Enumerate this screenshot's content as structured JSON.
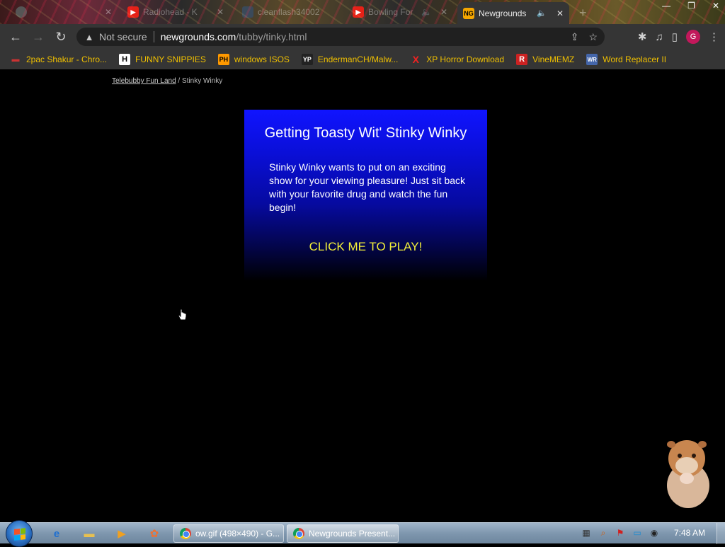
{
  "tabs": [
    {
      "title": "",
      "fav": "",
      "kind": "blank",
      "active": false
    },
    {
      "title": "Radiohead - K",
      "fav": "▶",
      "kind": "yt",
      "active": false
    },
    {
      "title": "cleanflash34002",
      "fav": "",
      "kind": "blank",
      "active": false
    },
    {
      "title": "Bowling For",
      "fav": "▶",
      "kind": "yt",
      "active": false
    },
    {
      "title": "Newgrounds",
      "fav": "NG",
      "kind": "ng",
      "active": true
    }
  ],
  "toolbar": {
    "security_label": "Not secure",
    "url_host": "newgrounds.com",
    "url_path": "/tubby/tinky.html",
    "profile_initial": "G"
  },
  "bookmarks": [
    {
      "label": "2pac Shakur - Chro...",
      "icon": "▬",
      "color": "#c33"
    },
    {
      "label": "FUNNY SNIPPIES",
      "icon": "H",
      "color": "#222"
    },
    {
      "label": "windows ISOS",
      "icon": "PH",
      "color": "#f90"
    },
    {
      "label": "EndermanCH/Malw...",
      "icon": "YP",
      "color": "#222"
    },
    {
      "label": "XP Horror Download",
      "icon": "X",
      "color": "#e22"
    },
    {
      "label": "VineMEMZ",
      "icon": "R",
      "color": "#c22"
    },
    {
      "label": "Word Replacer II",
      "icon": "WR",
      "color": "#468"
    }
  ],
  "page": {
    "breadcrumb_link": "Telebubby Fun Land",
    "breadcrumb_sep": " / ",
    "breadcrumb_current": "Stinky Winky",
    "promo_title": "Getting Toasty Wit' Stinky Winky",
    "promo_description": "Stinky Winky wants to put on an exciting show for your viewing pleasure! Just sit back with your favorite drug and watch the fun begin!",
    "play_label": "CLICK ME TO PLAY!"
  },
  "taskbar": {
    "tasks": [
      {
        "label": "ow.gif (498×490) - G...",
        "active": false
      },
      {
        "label": "Newgrounds Present...",
        "active": true
      }
    ],
    "clock": "7:48 AM"
  }
}
